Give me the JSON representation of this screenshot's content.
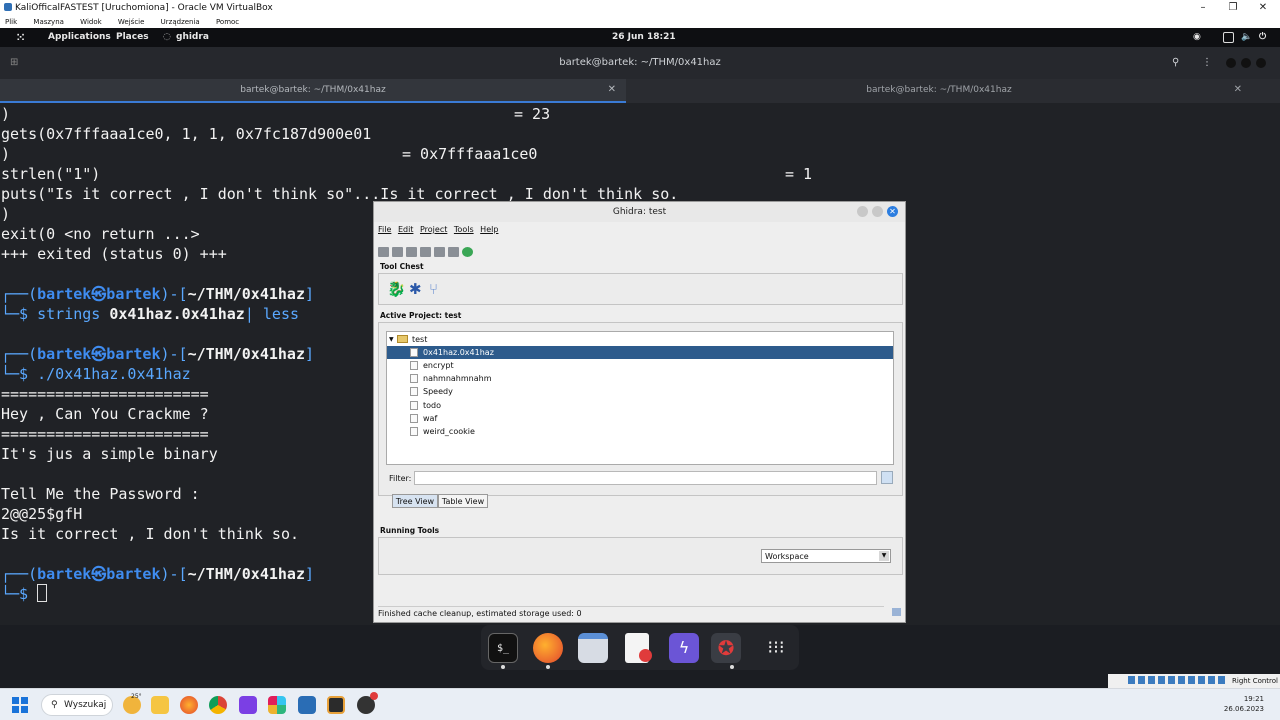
{
  "vbox": {
    "title": "KaliOfficalFASTEST [Uruchomiona] - Oracle VM VirtualBox",
    "menu": [
      "Plik",
      "Maszyna",
      "Widok",
      "Wejście",
      "Urządzenia",
      "Pomoc"
    ],
    "status_right": "Right Control"
  },
  "kali_panel": {
    "applications": "Applications",
    "places": "Places",
    "ghidra": "ghidra",
    "datetime": "26 Jun  18:21"
  },
  "terminal": {
    "window_title": "bartek@bartek: ~/THM/0x41haz",
    "tabs": [
      "bartek@bartek: ~/THM/0x41haz",
      "bartek@bartek: ~/THM/0x41haz"
    ],
    "lines": {
      "l1a": ")",
      "l1b": "= 23",
      "l2": "gets(0x7fffaaa1ce0, 1, 1, 0x7fc187d900e01",
      "l3a": ")",
      "l3b": "= 0x7fffaaa1ce0",
      "l4a": "strlen(\"1\")",
      "l4b": "= 1",
      "l5": "puts(\"Is it correct , I don't think so\"...Is it correct , I don't think so.",
      "l6": ")",
      "l7": "exit(0 <no return ...>",
      "l8": "+++ exited (status 0) +++",
      "prompt_open": "┌──(",
      "prompt_user": "bartek㉿bartek",
      "prompt_mid": ")-[",
      "prompt_path": "~/THM/0x41haz",
      "prompt_close": "]",
      "prompt_dollar": "└─$ ",
      "cmd1_a": "strings ",
      "cmd1_b": "0x41haz.0x41haz",
      "cmd1_c": "| less",
      "cmd2": "./0x41haz.0x41haz",
      "sep": "=======================",
      "hey": "Hey , Can You Crackme ?",
      "simple": "It's jus a simple binary",
      "tell": "Tell Me the Password :",
      "pw": "2@@25$gfH",
      "wrong": "Is it correct , I don't think so."
    }
  },
  "ghidra": {
    "title": "Ghidra: test",
    "menu": [
      "File",
      "Edit",
      "Project",
      "Tools",
      "Help"
    ],
    "tool_chest_label": "Tool Chest",
    "active_project_label": "Active Project: test",
    "tree_root": "test",
    "tree_items": [
      "0x41haz.0x41haz",
      "encrypt",
      "nahmnahmnahm",
      "Speedy",
      "todo",
      "waf",
      "weird_cookie"
    ],
    "selected_item": "0x41haz.0x41haz",
    "filter_label": "Filter:",
    "tree_view_tab": "Tree View",
    "table_view_tab": "Table View",
    "running_tools_label": "Running Tools",
    "workspace_value": "Workspace",
    "status": "Finished cache cleanup, estimated storage used: 0"
  },
  "taskbar": {
    "search_label": "Wyszukaj",
    "weather": "25°",
    "time": "19:21",
    "date": "26.06.2023"
  },
  "colors": {
    "terminal_bg": "#202226",
    "prompt_blue": "#3f8cf0",
    "selection": "#2d5b8c",
    "ghidra_bg": "#eeeeee"
  }
}
